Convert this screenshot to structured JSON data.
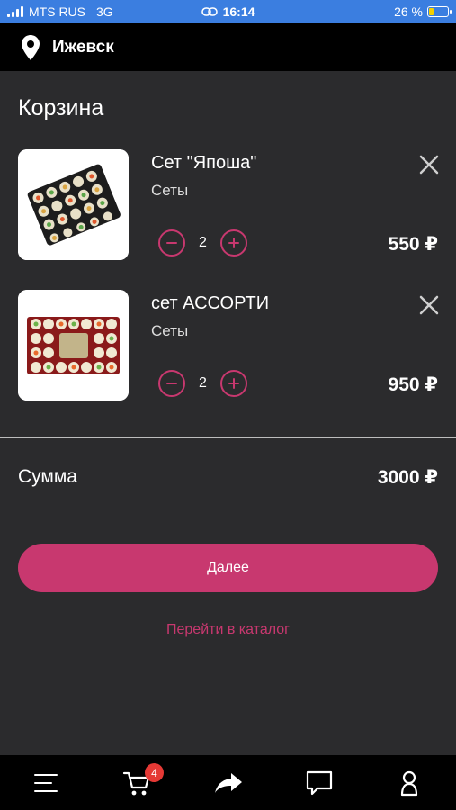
{
  "status_bar": {
    "carrier": "MTS RUS",
    "network": "3G",
    "time": "16:14",
    "battery_percent": "26 %",
    "battery_level": 0.26
  },
  "header": {
    "city": "Ижевск",
    "icon": "location-pin-icon"
  },
  "page_title": "Корзина",
  "cart_items": [
    {
      "name": "Сет \"Япоша\"",
      "category": "Сеты",
      "quantity": "2",
      "price": "550 ₽"
    },
    {
      "name": "сет АССОРТИ",
      "category": "Сеты",
      "quantity": "2",
      "price": "950 ₽"
    }
  ],
  "summary": {
    "label": "Сумма",
    "value": "3000 ₽"
  },
  "actions": {
    "next_label": "Далее",
    "catalog_label": "Перейти в каталог"
  },
  "tab_bar": {
    "cart_badge": "4",
    "icons": [
      "menu-icon",
      "cart-icon",
      "share-icon",
      "chat-icon",
      "profile-icon"
    ]
  },
  "colors": {
    "accent": "#c8386f",
    "background": "#2b2b2d",
    "status_bar": "#3b7ee0",
    "badge": "#e53935"
  }
}
